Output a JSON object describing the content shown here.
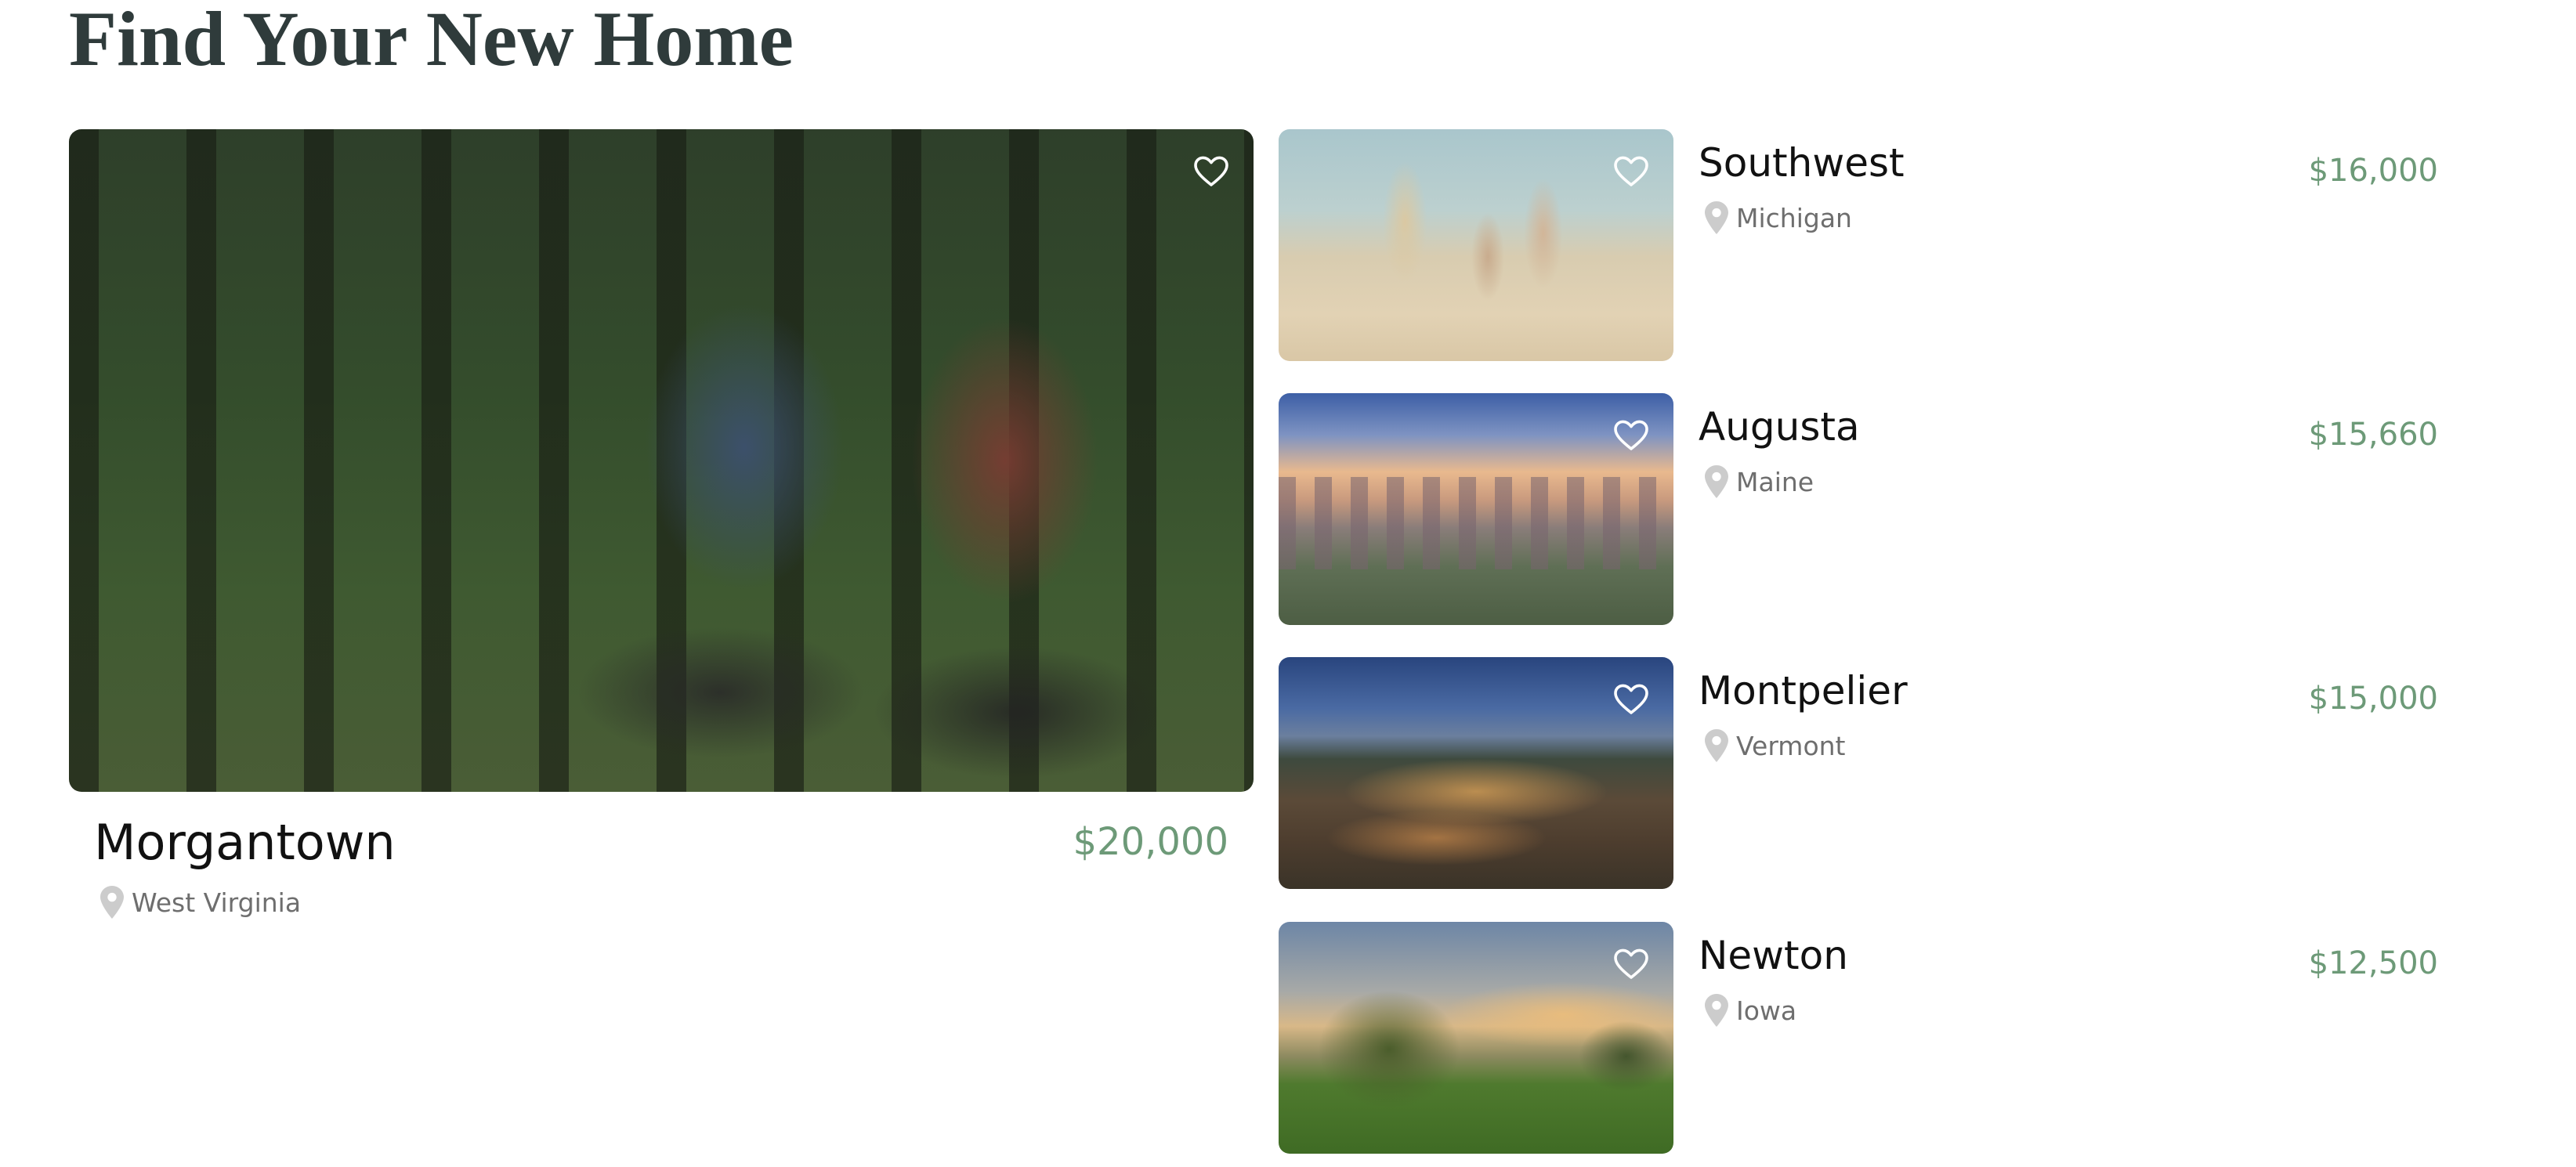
{
  "page": {
    "title": "Find Your New Home"
  },
  "featured": {
    "name": "Morgantown",
    "state": "West Virginia",
    "price": "$20,000",
    "image": "forest-cyclists-photo",
    "favorite_icon": "heart-outline-icon",
    "location_icon": "map-pin-icon"
  },
  "listings": [
    {
      "name": "Southwest",
      "state": "Michigan",
      "price": "$16,000",
      "image": "beach-children-photo",
      "favorite_icon": "heart-outline-icon",
      "location_icon": "map-pin-icon"
    },
    {
      "name": "Augusta",
      "state": "Maine",
      "price": "$15,660",
      "image": "city-dusk-photo",
      "favorite_icon": "heart-outline-icon",
      "location_icon": "map-pin-icon"
    },
    {
      "name": "Montpelier",
      "state": "Vermont",
      "price": "$15,000",
      "image": "town-night-photo",
      "favorite_icon": "heart-outline-icon",
      "location_icon": "map-pin-icon"
    },
    {
      "name": "Newton",
      "state": "Iowa",
      "price": "$12,500",
      "image": "field-tree-photo",
      "favorite_icon": "heart-outline-icon",
      "location_icon": "map-pin-icon"
    }
  ],
  "colors": {
    "title": "#2f3b3b",
    "price": "#6d9a78",
    "location_text": "#6e6e6e",
    "pin": "#cccccc",
    "heart": "#ffffff"
  }
}
